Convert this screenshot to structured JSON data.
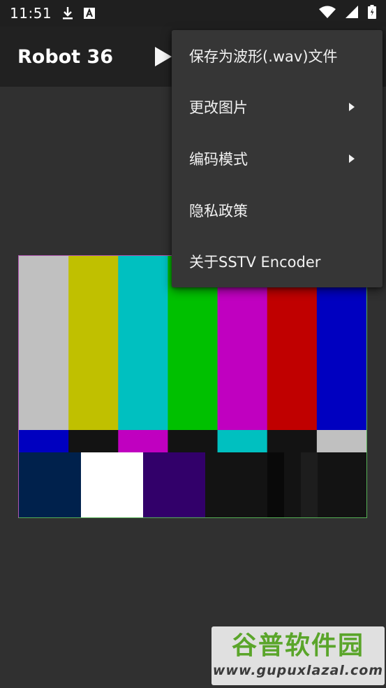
{
  "status_bar": {
    "time": "11:51"
  },
  "app_bar": {
    "title": "Robot 36"
  },
  "test_pattern": {
    "top_bars": [
      "#c0c0c0",
      "#c0c000",
      "#00c0c0",
      "#00c000",
      "#c000c0",
      "#c00000",
      "#0000c0"
    ],
    "middle_bars": [
      "#0000c0",
      "#131313",
      "#c000c0",
      "#131313",
      "#00c0c0",
      "#131313",
      "#c0c0c0"
    ],
    "bottom_blocks": [
      "#00214c",
      "#ffffff",
      "#32006a",
      "#131313",
      "#090909",
      "#131313",
      "#1d1d1d",
      "#131313"
    ]
  },
  "menu": {
    "items": [
      {
        "label": "保存为波形(.wav)文件",
        "submenu": false
      },
      {
        "label": "更改图片",
        "submenu": true
      },
      {
        "label": "编码模式",
        "submenu": true
      },
      {
        "label": "隐私政策",
        "submenu": false
      },
      {
        "label": "关于SSTV Encoder",
        "submenu": false
      }
    ]
  },
  "watermark": {
    "text": "谷普软件园",
    "url": "www.gupuxlazal.com"
  },
  "colors": {
    "background": "#303030",
    "app_bar": "#212121",
    "status_bar": "#1f1f1f",
    "menu": "#363636",
    "watermark_green": "#5aa52a"
  },
  "icons": [
    "download-icon",
    "font-a-icon",
    "wifi-icon",
    "signal-icon",
    "battery-icon",
    "play-icon",
    "submenu-arrow-icon"
  ]
}
